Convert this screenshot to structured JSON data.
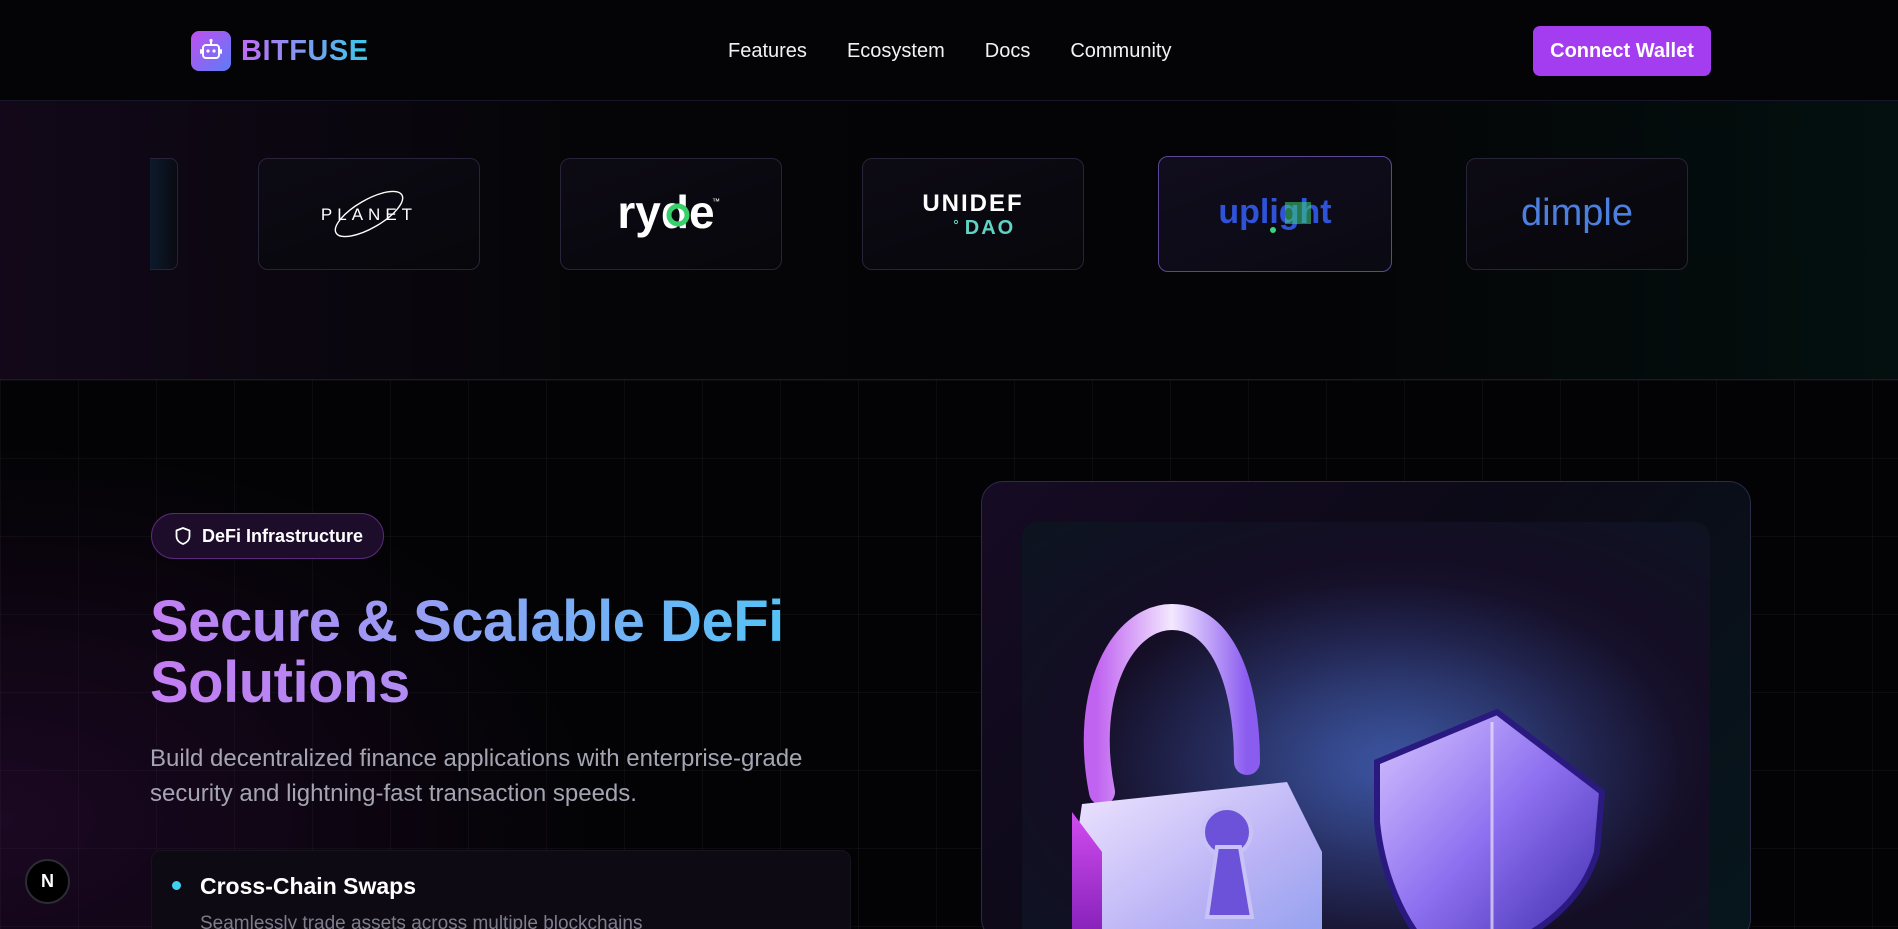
{
  "nav": {
    "logo_text": "BITFUSE",
    "links": [
      "Features",
      "Ecosystem",
      "Docs",
      "Community"
    ],
    "cta": "Connect Wallet"
  },
  "partners": [
    {
      "name": "PLANET",
      "logo_text": "PLANET"
    },
    {
      "name": "ryde",
      "logo_text": "ryde",
      "mark": "™"
    },
    {
      "name": "UNIDEF DAO",
      "logo_line1": "UNIDEF",
      "logo_line2": "DAO"
    },
    {
      "name": "uplight",
      "logo_text": "uplight"
    },
    {
      "name": "dimple",
      "logo_text": "dimple"
    }
  ],
  "hero": {
    "badge": "DeFi Infrastructure",
    "title_line1": "Secure & Scalable DeFi",
    "title_line2": "Solutions",
    "subtitle": "Build decentralized finance applications with enterprise-grade security and lightning-fast transaction speeds.",
    "features": [
      {
        "title": "Cross-Chain Swaps",
        "description": "Seamlessly trade assets across multiple blockchains"
      }
    ]
  },
  "next_badge": "N",
  "colors": {
    "accent": "#a43df0",
    "gradient_start": "#c37df2",
    "gradient_end": "#55c2f5",
    "background": "#030305"
  },
  "icons": {
    "logo": "robot-icon",
    "badge": "shield-icon",
    "hero_visual": "padlock-shield-illustration"
  }
}
